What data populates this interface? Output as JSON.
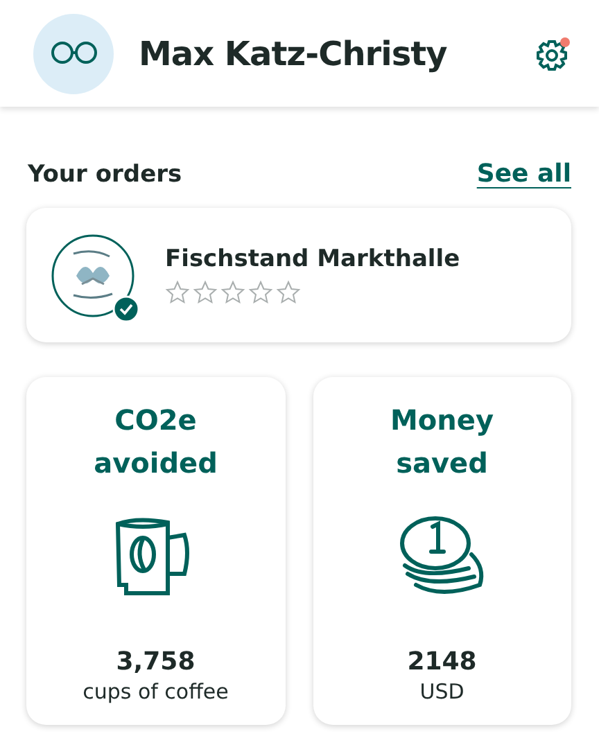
{
  "header": {
    "name": "Max Katz-Christy",
    "settings_notification": true
  },
  "orders": {
    "title": "Your orders",
    "link": "See all",
    "items": [
      {
        "store": "Fischstand Markthalle",
        "verified": true,
        "stars": 0
      }
    ]
  },
  "stats": [
    {
      "kind": "co2",
      "title": "CO2e avoided",
      "value": "3,758",
      "unit": "cups of coffee"
    },
    {
      "kind": "money",
      "title": "Money saved",
      "value": "2148",
      "unit": "USD"
    }
  ]
}
